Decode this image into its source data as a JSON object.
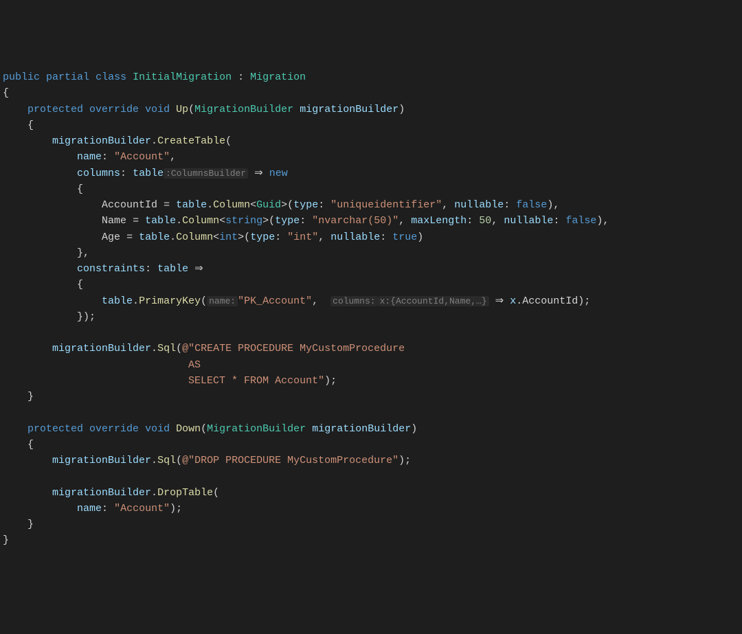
{
  "kw": {
    "public": "public",
    "partial": "partial",
    "class": "class",
    "protected": "protected",
    "override": "override",
    "void": "void",
    "new": "new",
    "false": "false",
    "true": "true"
  },
  "types": {
    "InitialMigration": "InitialMigration",
    "Migration": "Migration",
    "MigrationBuilder": "MigrationBuilder",
    "Guid": "Guid",
    "string": "string",
    "int": "int"
  },
  "methods": {
    "Up": "Up",
    "Down": "Down",
    "CreateTable": "CreateTable",
    "Column": "Column",
    "PrimaryKey": "PrimaryKey",
    "Sql": "Sql",
    "DropTable": "DropTable"
  },
  "params": {
    "migrationBuilder": "migrationBuilder",
    "name": "name",
    "columns": "columns",
    "table": "table",
    "type": "type",
    "nullable": "nullable",
    "maxLength": "maxLength",
    "constraints": "constraints",
    "x": "x"
  },
  "props": {
    "AccountId": "AccountId",
    "Name": "Name",
    "Age": "Age"
  },
  "strings": {
    "Account": "\"Account\"",
    "uniqueidentifier": "\"uniqueidentifier\"",
    "nvarchar50": "\"nvarchar(50)\"",
    "int": "\"int\"",
    "PK_Account": "\"PK_Account\"",
    "createProc": "@\"CREATE PROCEDURE MyCustomProcedure",
    "as": "AS",
    "select": "SELECT * FROM Account\"",
    "dropProc": "@\"DROP PROCEDURE MyCustomProcedure\""
  },
  "nums": {
    "fifty": "50"
  },
  "hints": {
    "columnsBuilder": ":ColumnsBuilder",
    "nameHint": "name:",
    "columnsHint": "columns:",
    "xHint": "x:{AccountId,Name,…}"
  },
  "arrow": "⇒"
}
